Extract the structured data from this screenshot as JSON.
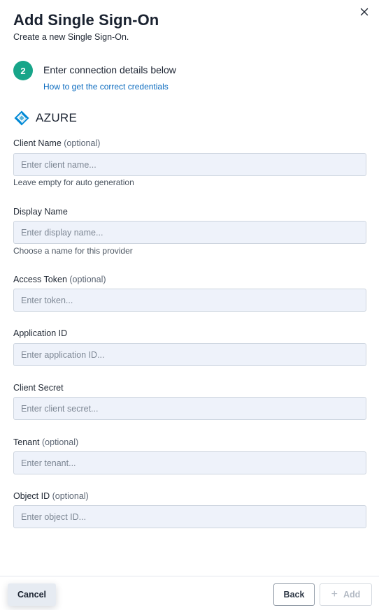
{
  "dialog": {
    "title": "Add Single Sign-On",
    "subtitle": "Create a new Single Sign-On.",
    "close_icon": "close-icon"
  },
  "step": {
    "number": "2",
    "title": "Enter connection details below",
    "help_link": "How to get the correct credentials",
    "accent_color": "#17a589"
  },
  "provider": {
    "name": "AZURE",
    "icon": "azure-logo-icon"
  },
  "fields": {
    "client_name": {
      "label": "Client Name",
      "optional": "(optional)",
      "placeholder": "Enter client name...",
      "hint": "Leave empty for auto generation"
    },
    "display_name": {
      "label": "Display Name",
      "placeholder": "Enter display name...",
      "hint": "Choose a name for this provider"
    },
    "access_token": {
      "label": "Access Token",
      "optional": "(optional)",
      "placeholder": "Enter token..."
    },
    "application_id": {
      "label": "Application ID",
      "placeholder": "Enter application ID..."
    },
    "client_secret": {
      "label": "Client Secret",
      "placeholder": "Enter client secret..."
    },
    "tenant": {
      "label": "Tenant",
      "optional": "(optional)",
      "placeholder": "Enter tenant..."
    },
    "object_id": {
      "label": "Object ID",
      "optional": "(optional)",
      "placeholder": "Enter object ID..."
    }
  },
  "footer": {
    "cancel_label": "Cancel",
    "back_label": "Back",
    "add_label": "Add",
    "add_icon": "plus-icon"
  }
}
